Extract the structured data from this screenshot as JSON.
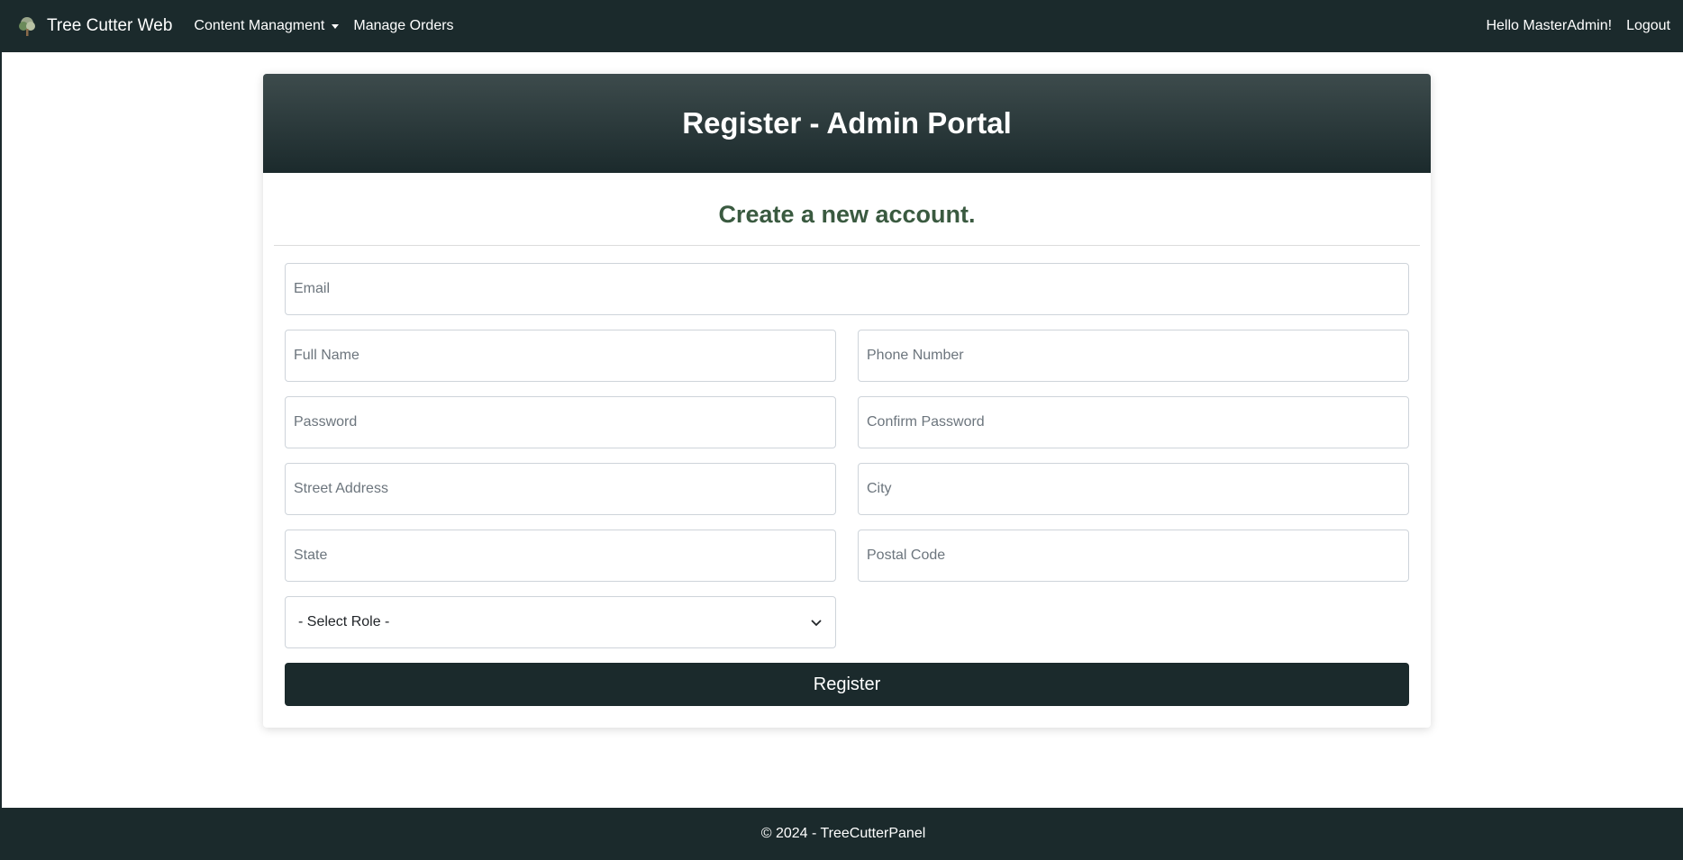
{
  "navbar": {
    "brand": "Tree Cutter Web",
    "brand_icon": "tree-icon",
    "links": [
      {
        "label": "Content Managment",
        "dropdown": true
      },
      {
        "label": "Manage Orders",
        "dropdown": false
      }
    ],
    "greeting": "Hello MasterAdmin!",
    "logout": "Logout"
  },
  "card": {
    "title": "Register - Admin Portal",
    "subtitle": "Create a new account."
  },
  "form": {
    "email_placeholder": "Email",
    "full_name_placeholder": "Full Name",
    "phone_placeholder": "Phone Number",
    "password_placeholder": "Password",
    "confirm_password_placeholder": "Confirm Password",
    "street_placeholder": "Street Address",
    "city_placeholder": "City",
    "state_placeholder": "State",
    "postal_placeholder": "Postal Code",
    "role_selected": "- Select Role -",
    "register_label": "Register"
  },
  "footer": {
    "text": "© 2024 - TreeCutterPanel"
  },
  "colors": {
    "primary": "#1b2a2c",
    "subtitle": "#3a5a40"
  }
}
